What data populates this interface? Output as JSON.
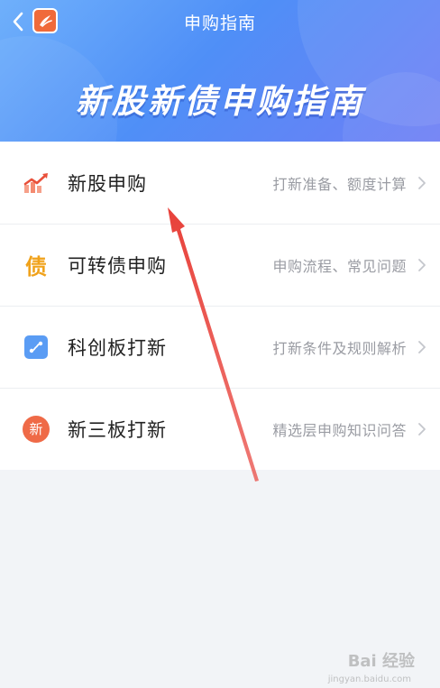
{
  "header": {
    "nav_title": "申购指南",
    "banner_title": "新股新债申购指南"
  },
  "list": {
    "items": [
      {
        "label": "新股申购",
        "desc": "打新准备、额度计算",
        "icon": "trend-chart-icon"
      },
      {
        "label": "可转债申购",
        "desc": "申购流程、常见问题",
        "icon": "bond-icon",
        "icon_text": "债"
      },
      {
        "label": "科创板打新",
        "desc": "打新条件及规则解析",
        "icon": "star-board-icon"
      },
      {
        "label": "新三板打新",
        "desc": "精选层申购知识问答",
        "icon": "new-badge-icon",
        "icon_text": "新"
      }
    ]
  },
  "watermark": {
    "text": "Bai 经验",
    "sub": "jingyan.baidu.com"
  },
  "colors": {
    "header_gradient_start": "#6fb0fb",
    "header_gradient_end": "#6e7ef5",
    "annotation_arrow": "#e8413a",
    "page_background": "#f2f4f7"
  }
}
